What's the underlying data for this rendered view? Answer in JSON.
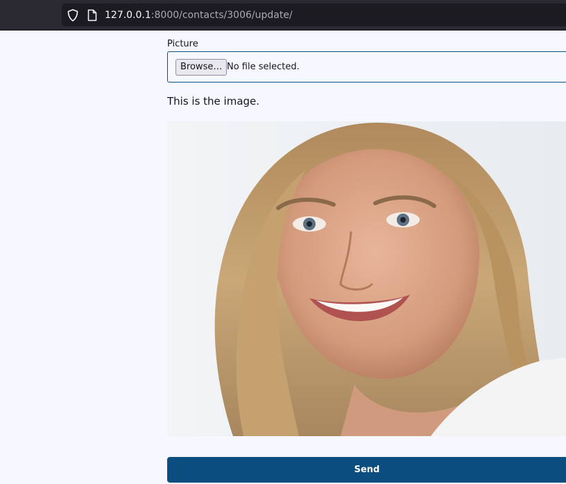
{
  "browser": {
    "url_host": "127.0.0.1",
    "url_path": ":8000/contacts/3006/update/",
    "icons": [
      "shield-icon",
      "page-icon"
    ]
  },
  "form": {
    "picture_label": "Picture",
    "browse_label": "Browse…",
    "file_status": "No file selected.",
    "image_caption": "This is the image.",
    "image_description": "portrait-photo",
    "send_label": "Send"
  },
  "colors": {
    "page_background": "#f7f7ff",
    "accent": "#0b4d7f",
    "input_border": "#0b4f7e"
  }
}
